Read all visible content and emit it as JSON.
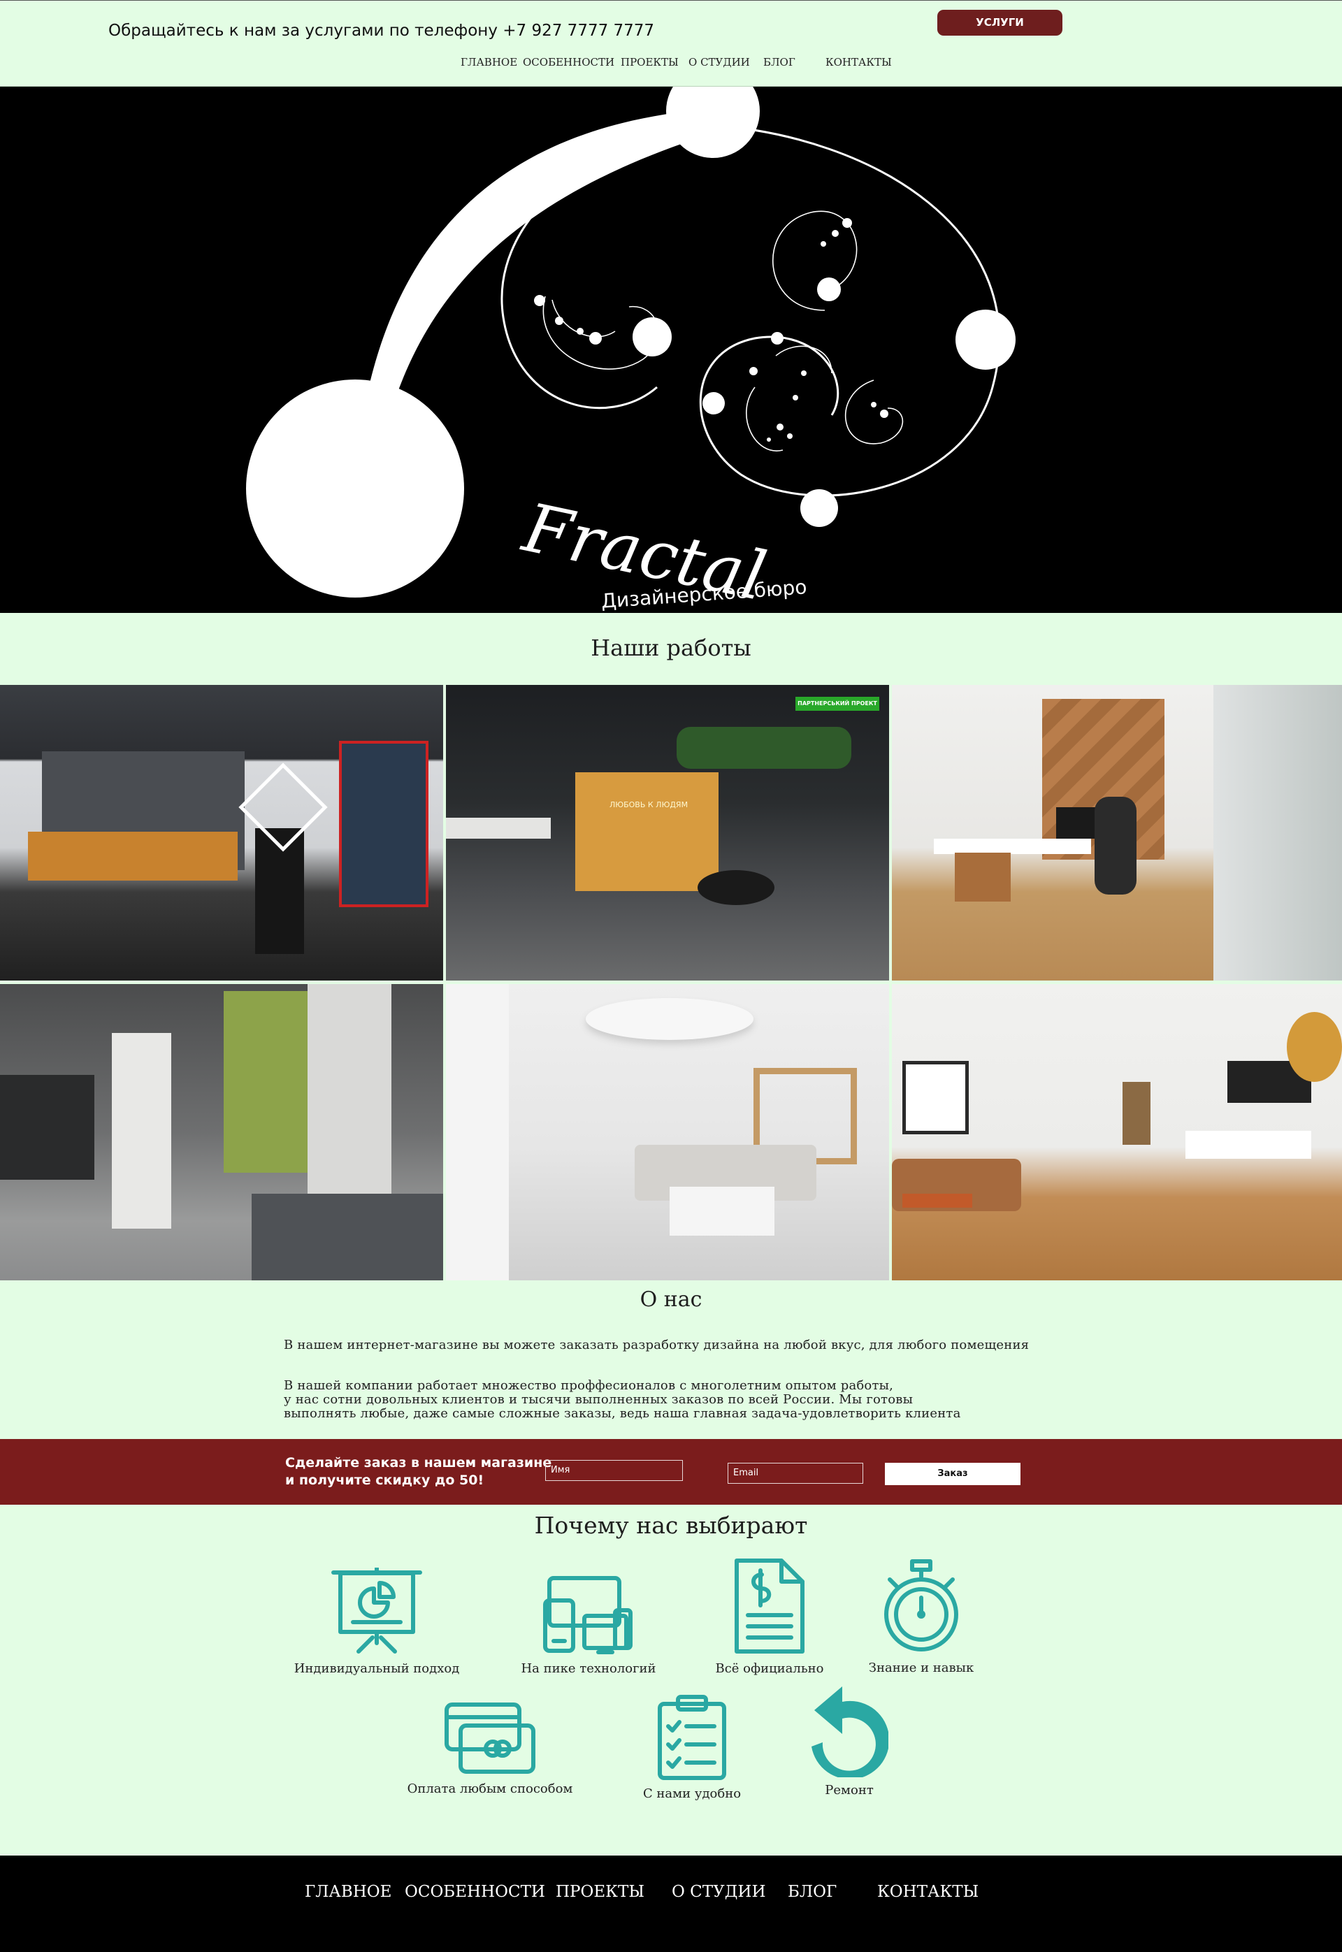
{
  "header": {
    "phone_text": "Обращайтесь к нам за услугами по телефону +7 927 7777 7777",
    "services_button": "УСЛУГИ",
    "nav": [
      "ГЛАВНОЕ",
      "ОСОБЕННОСТИ",
      "ПРОЕКТЫ",
      "О СТУДИИ",
      "БЛОГ",
      "КОНТАКТЫ"
    ]
  },
  "hero": {
    "logo_word": "Fractal",
    "logo_subtitle": "Дизайнерское бюро"
  },
  "works": {
    "title": "Наши работы",
    "badge": "ПАРТНЕРСЬКИЙ ПРОЕКТ",
    "neon_sign": "ЛЮБОВЬ К ЛЮДЯМ"
  },
  "about": {
    "title": "О нас",
    "paragraph1": "В нашем интернет-магазине вы можете заказать разработку дизайна на любой вкус, для любого помещения",
    "paragraph2_lines": [
      "В нашей компании работает множество проффесионалов с многолетним опытом работы,",
      "у нас сотни довольных клиентов и тысячи выполненных заказов по всей России. Мы готовы",
      "выполнять любые, даже самые сложные заказы, ведь наша главная задача-удовлетворить клиента"
    ]
  },
  "order": {
    "text_line1": "Сделайте заказ в нашем магазине",
    "text_line2": "и получите скидку до 50!",
    "name_placeholder": "Имя",
    "email_placeholder": "Email",
    "submit_label": "Заказ"
  },
  "features": {
    "title": "Почему нас выбирают",
    "items": [
      {
        "label": "Индивидуальный подход",
        "icon": "presentation-board-icon"
      },
      {
        "label": "На пике технологий",
        "icon": "devices-icon"
      },
      {
        "label": "Всё официально",
        "icon": "document-dollar-icon"
      },
      {
        "label": "Знание и навык",
        "icon": "stopwatch-icon"
      },
      {
        "label": "Оплата любым способом",
        "icon": "credit-cards-icon"
      },
      {
        "label": "С нами удобно",
        "icon": "checklist-clipboard-icon"
      },
      {
        "label": "Ремонт",
        "icon": "refresh-arrow-icon"
      }
    ],
    "icon_color": "#2aa8a3"
  },
  "footer": {
    "nav": [
      "ГЛАВНОЕ",
      "ОСОБЕННОСТИ",
      "ПРОЕКТЫ",
      "О СТУДИИ",
      "БЛОГ",
      "КОНТАКТЫ"
    ]
  },
  "colors": {
    "page_bg": "#e3fde4",
    "accent_maroon": "#7b1c1c",
    "hero_bg": "#000000",
    "footer_bg": "#000000",
    "icon_teal": "#2aa8a3"
  }
}
